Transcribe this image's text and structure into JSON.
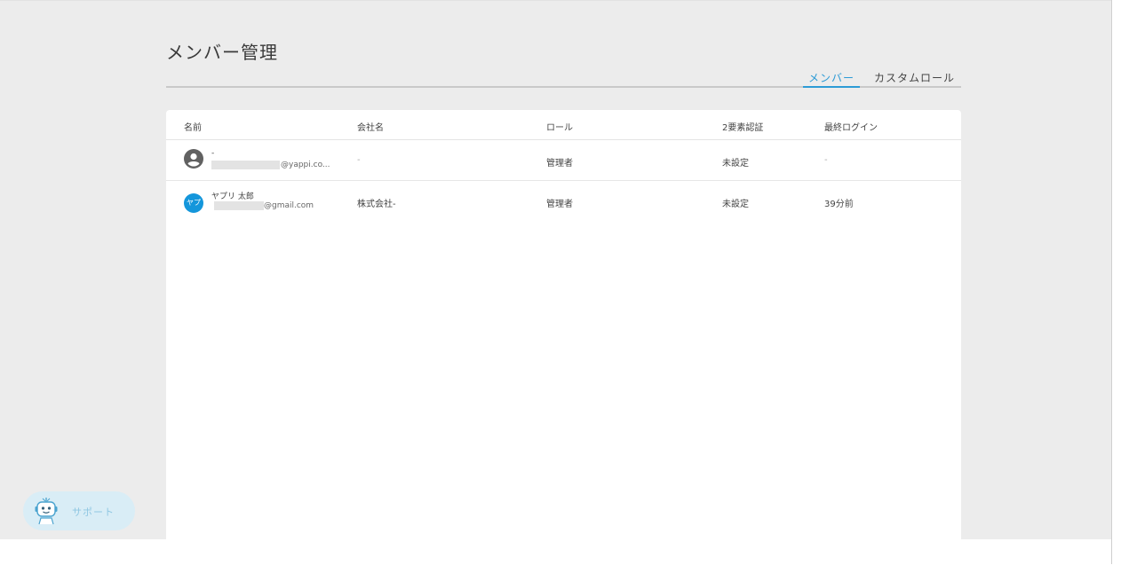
{
  "page": {
    "title": "メンバー管理"
  },
  "tabs": [
    {
      "label": "メンバー",
      "active": true
    },
    {
      "label": "カスタムロール",
      "active": false
    }
  ],
  "table": {
    "columns": [
      "名前",
      "会社名",
      "ロール",
      "2要素認証",
      "最終ログイン"
    ],
    "rows": [
      {
        "name": "-",
        "email_suffix": "@yappi.co...",
        "company": "-",
        "role": "管理者",
        "two_factor": "未設定",
        "last_login": "-",
        "avatar": "person-icon"
      },
      {
        "name": "ヤプリ 太郎",
        "email_suffix": "@gmail.com",
        "company": "株式会社-",
        "role": "管理者",
        "two_factor": "未設定",
        "last_login": "39分前",
        "avatar_text": "ヤプ"
      }
    ]
  },
  "support": {
    "label": "サポート",
    "icon": "robot-icon"
  },
  "colors": {
    "accent": "#2d9bd6",
    "avatar_bg": "#1496db",
    "background": "#ececec",
    "support_bg": "#d9edf6"
  }
}
